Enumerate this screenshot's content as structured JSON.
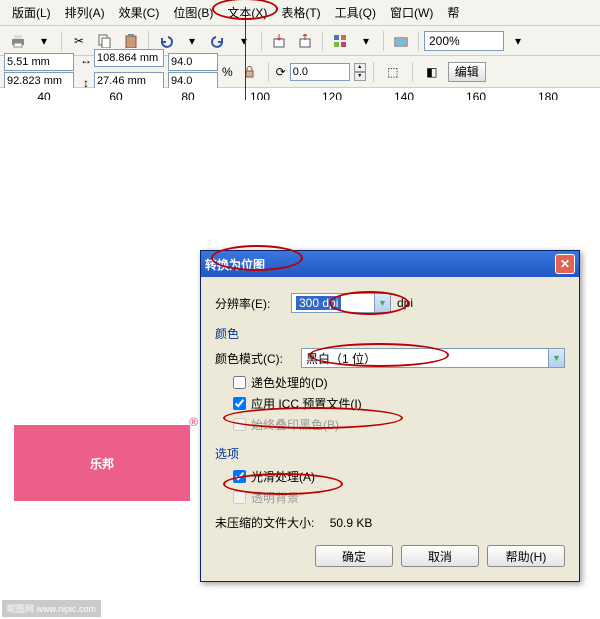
{
  "menubar": [
    "版面(L)",
    "排列(A)",
    "效果(C)",
    "位图(B)",
    "文本(X)",
    "表格(T)",
    "工具(Q)",
    "窗口(W)",
    "帮"
  ],
  "zoom": "200%",
  "props": {
    "x": "5.51 mm",
    "y": "92.823 mm",
    "w": "108.864 mm",
    "h": "27.46 mm",
    "sx": "94.0",
    "sy": "94.0",
    "pct": "%",
    "angle": "0.0",
    "edit_btn": "编辑"
  },
  "ruler_ticks": [
    "40",
    "60",
    "80",
    "100",
    "120",
    "140",
    "160",
    "180"
  ],
  "logo_text": "乐邦",
  "logo_r": "®",
  "dlg": {
    "title": "转换为位图",
    "res_label": "分辨率(E):",
    "res_value": "300 dpi",
    "res_unit": "dpi",
    "group_color": "颜色",
    "mode_label": "颜色模式(C):",
    "mode_value": "黑白（1 位）",
    "chk_dither": "递色处理的(D)",
    "chk_icc": "应用 ICC 预置文件(I)",
    "chk_black": "始终叠印黑色(B)",
    "group_opt": "选项",
    "chk_aa": "光滑处理(A)",
    "chk_trans": "透明背景",
    "filesize_label": "未压缩的文件大小:",
    "filesize_value": "50.9 KB",
    "btn_ok": "确定",
    "btn_cancel": "取消",
    "btn_help": "帮助(H)"
  }
}
